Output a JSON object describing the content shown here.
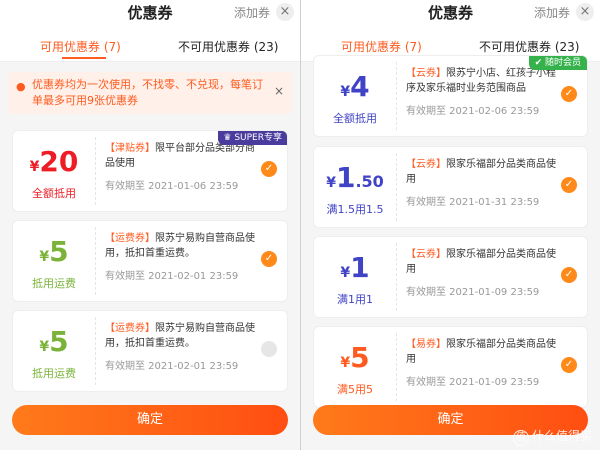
{
  "left": {
    "title": "优惠券",
    "add_label": "添加券",
    "close_glyph": "×",
    "tabs": [
      {
        "label": "可用优惠券 (7)",
        "active": true
      },
      {
        "label": "不可用优惠券 (23)",
        "active": false
      }
    ],
    "notice": {
      "text": "优惠券均为一次使用，不找零、不兑现，每笔订单最多可用9张优惠券",
      "close_glyph": "×"
    },
    "coupons": [
      {
        "currency": "¥",
        "amount": "20",
        "condition": "全额抵用",
        "tag": "【津贴券】",
        "desc": "限平台部分品类部分商品使用",
        "valid": "有效期至 2021-01-06 23:59",
        "checked": true,
        "badge": "SUPER专享"
      },
      {
        "currency": "¥",
        "amount": "5",
        "condition": "抵用运费",
        "tag": "【运费券】",
        "desc": "限苏宁易购自营商品使用，抵扣首重运费。",
        "valid": "有效期至 2021-02-01 23:59",
        "checked": true
      },
      {
        "currency": "¥",
        "amount": "5",
        "condition": "抵用运费",
        "tag": "【运费券】",
        "desc": "限苏宁易购自营商品使用，抵扣首重运费。",
        "valid": "有效期至 2021-02-01 23:59",
        "checked": false
      }
    ],
    "confirm_label": "确定"
  },
  "right": {
    "title": "优惠券",
    "add_label": "添加券",
    "close_glyph": "×",
    "tabs": [
      {
        "label": "可用优惠券 (7)",
        "active": true
      },
      {
        "label": "不可用优惠券 (23)",
        "active": false
      }
    ],
    "coupons": [
      {
        "currency": "¥",
        "amount": "4",
        "condition": "全额抵用",
        "tag": "【云券】",
        "desc": "限苏宁小店、红孩子小程序及家乐福时业务范围商品",
        "valid": "有效期至 2021-02-06 23:59",
        "checked": true,
        "badge": "随时会员"
      },
      {
        "currency": "¥",
        "amount": "1",
        "decimal": ".50",
        "condition": "满1.5用1.5",
        "tag": "【云券】",
        "desc": "限家乐福部分品类商品使用",
        "valid": "有效期至 2021-01-31 23:59",
        "checked": true
      },
      {
        "currency": "¥",
        "amount": "1",
        "condition": "满1用1",
        "tag": "【云券】",
        "desc": "限家乐福部分品类商品使用",
        "valid": "有效期至 2021-01-09 23:59",
        "checked": true
      },
      {
        "currency": "¥",
        "amount": "5",
        "condition": "满5用5",
        "tag": "【易券】",
        "desc": "限家乐福部分品类商品使用",
        "valid": "有效期至 2021-01-09 23:59",
        "checked": true
      }
    ],
    "confirm_label": "确定"
  },
  "watermark": "什么值得买",
  "colors": {
    "accent": "#ff5a1f",
    "red": "#ee1c25",
    "green": "#7bb33a",
    "blue": "#4043c5",
    "super_badge": "#4a3b9e",
    "member_badge": "#35b24c"
  }
}
